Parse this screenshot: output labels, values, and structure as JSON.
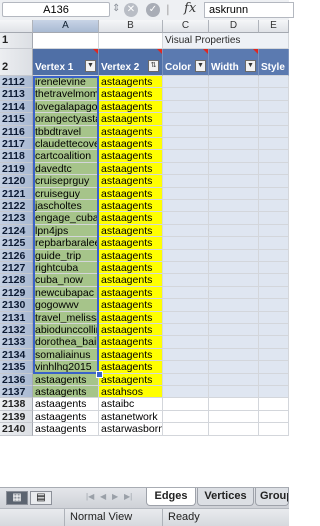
{
  "formula_bar": {
    "name_box": "A136",
    "formula_text": "askrunn"
  },
  "icons": {
    "cancel": "cancel-icon",
    "confirm": "check-icon",
    "fx": "fx"
  },
  "columns": [
    "A",
    "B",
    "C",
    "D",
    "E"
  ],
  "visual_properties_label": "Visual Properties",
  "table_headers": [
    "Vertex 1",
    "Vertex 2",
    "Color",
    "Width",
    "Style"
  ],
  "rows": [
    {
      "num": "1"
    },
    {
      "num": "2"
    },
    {
      "num": "2112",
      "v1": "irenelevine",
      "v2": "astaagents"
    },
    {
      "num": "2113",
      "v1": "thetravelmom",
      "v2": "astaagents"
    },
    {
      "num": "2114",
      "v1": "lovegalapagos",
      "v2": "astaagents"
    },
    {
      "num": "2115",
      "v1": "orangectyastaagent",
      "v2": "astaagents"
    },
    {
      "num": "2116",
      "v1": "tbbdtravel",
      "v2": "astaagents"
    },
    {
      "num": "2117",
      "v1": "claudettecovey",
      "v2": "astaagents"
    },
    {
      "num": "2118",
      "v1": "cartcoalition",
      "v2": "astaagents"
    },
    {
      "num": "2119",
      "v1": "davedtc",
      "v2": "astaagents"
    },
    {
      "num": "2120",
      "v1": "cruiseprguy",
      "v2": "astaagents"
    },
    {
      "num": "2121",
      "v1": "cruiseguy",
      "v2": "astaagents"
    },
    {
      "num": "2122",
      "v1": "jascholtes",
      "v2": "astaagents"
    },
    {
      "num": "2123",
      "v1": "engage_cuba",
      "v2": "astaagents"
    },
    {
      "num": "2124",
      "v1": "lpn4jps",
      "v2": "astaagents"
    },
    {
      "num": "2125",
      "v1": "repbarbaralee",
      "v2": "astaagents"
    },
    {
      "num": "2126",
      "v1": "guide_trip",
      "v2": "astaagents"
    },
    {
      "num": "2127",
      "v1": "rightcuba",
      "v2": "astaagents"
    },
    {
      "num": "2128",
      "v1": "cuba_now",
      "v2": "astaagents"
    },
    {
      "num": "2129",
      "v1": "newcubapac",
      "v2": "astaagents"
    },
    {
      "num": "2130",
      "v1": "gogowwv",
      "v2": "astaagents"
    },
    {
      "num": "2131",
      "v1": "travel_melissa",
      "v2": "astaagents"
    },
    {
      "num": "2132",
      "v1": "abiodunccollins",
      "v2": "astaagents"
    },
    {
      "num": "2133",
      "v1": "dorothea_bailey",
      "v2": "astaagents"
    },
    {
      "num": "2134",
      "v1": "somaliainus",
      "v2": "astaagents"
    },
    {
      "num": "2135",
      "v1": "vinhlhq2015",
      "v2": "astaagents"
    },
    {
      "num": "2136",
      "v1": "astaagents",
      "v2": "astaagents"
    },
    {
      "num": "2137",
      "v1": "astaagents",
      "v2": "astahsos"
    },
    {
      "num": "2138",
      "v1": "astaagents",
      "v2": "astaibc"
    },
    {
      "num": "2139",
      "v1": "astaagents",
      "v2": "astanetwork"
    },
    {
      "num": "2140",
      "v1": "astaagents",
      "v2": "astarwasborninf"
    }
  ],
  "sheet_tabs": [
    "Edges",
    "Vertices",
    "Group"
  ],
  "active_tab": "Edges",
  "status": {
    "view": "Normal View",
    "state": "Ready"
  },
  "colors": {
    "header_blue": "#4f6fa6",
    "vertex1_fill": "#a6c48a",
    "vertex2_fill": "#ffff00",
    "visual_fill": "#dfe6f1",
    "selection": "#3a62c9"
  }
}
